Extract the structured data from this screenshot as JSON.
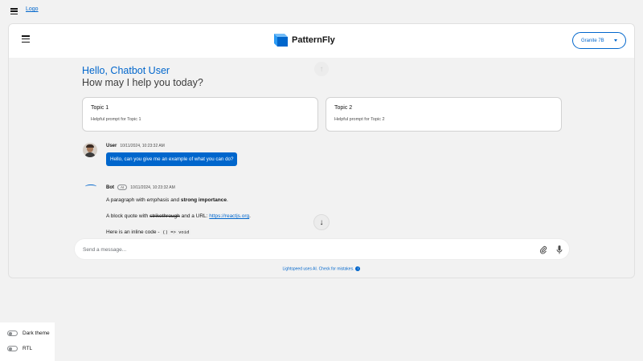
{
  "topbar": {
    "logo_label": "Logo"
  },
  "header": {
    "brand": "PatternFly",
    "model": "Granite 7B"
  },
  "welcome": {
    "line1": "Hello, Chatbot User",
    "line2": "How may I help you today?"
  },
  "prompts": [
    {
      "title": "Topic 1",
      "desc": "Helpful prompt for Topic 1"
    },
    {
      "title": "Topic 2",
      "desc": "Helpful prompt for Topic 2"
    }
  ],
  "user_message": {
    "name": "User",
    "time": "10/11/2024, 10:23:32 AM",
    "text": "Hello, can you give me an example of what you can do?"
  },
  "bot_message": {
    "name": "Bot",
    "badge": "AI",
    "time": "10/11/2024, 10:23:32 AM",
    "p1_before": "A paragraph with ",
    "p1_em": "emphasis",
    "p1_mid": " and ",
    "p1_strong": "strong importance",
    "p1_after": ".",
    "p2_before": "A block quote with ",
    "p2_strike": "strikethrough",
    "p2_mid": " and a URL: ",
    "p2_link": "https://reactjs.org",
    "p2_after": ".",
    "p3_before": "Here is an inline code - ",
    "p3_code": "() => void"
  },
  "composer": {
    "placeholder": "Send a message..."
  },
  "footer": {
    "disclaimer": "Lightspeed uses AI. Check for mistakes."
  },
  "settings": {
    "dark_theme": "Dark theme",
    "rtl": "RTL"
  },
  "colors": {
    "accent": "#0066cc"
  }
}
